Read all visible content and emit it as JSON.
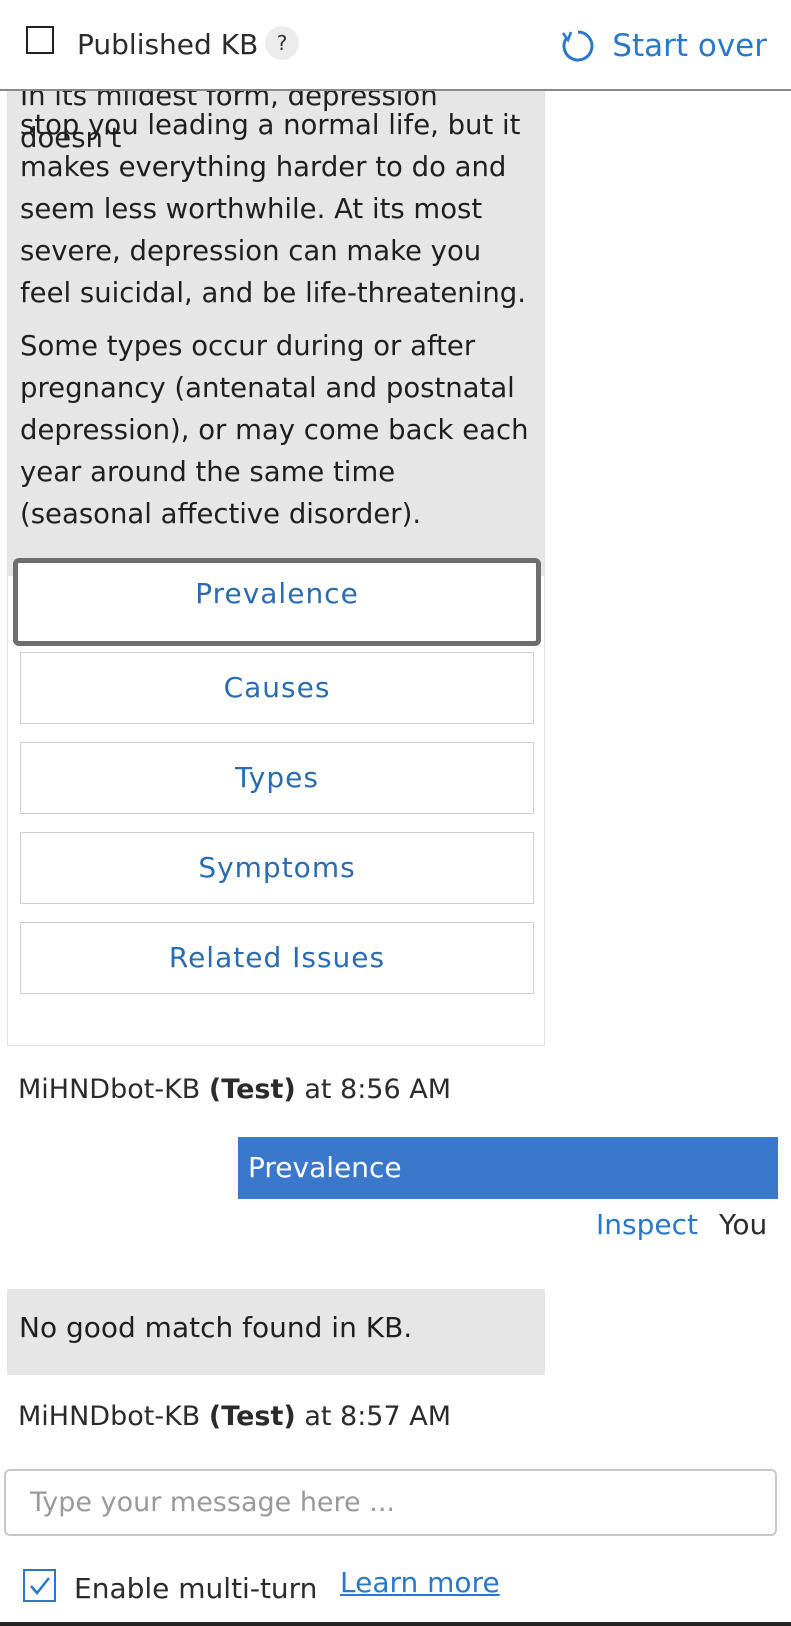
{
  "header": {
    "published_kb_label": "Published KB",
    "help_label": "?",
    "start_over_label": "Start over"
  },
  "bot_message": {
    "partial_line": "In its mildest form, depression doesn't",
    "paragraph_1": "stop you leading a normal life, but it makes everything harder to do and seem less worthwhile. At its most severe, depression can make you feel suicidal, and be life-threatening.",
    "paragraph_2": "Some types occur during or after pregnancy (antenatal and postnatal depression), or may come back each year around the same time (seasonal affective disorder).",
    "buttons": [
      "Prevalence",
      "Causes",
      "Types",
      "Symptoms",
      "Related Issues"
    ]
  },
  "meta_1": {
    "bot_name": "MiHNDbot-KB",
    "tag": "(Test)",
    "time": "at 8:56 AM"
  },
  "user_message": {
    "text": "Prevalence",
    "inspect_label": "Inspect",
    "sender": "You"
  },
  "bot_reply": {
    "text": "No good match found in KB."
  },
  "meta_2": {
    "bot_name": "MiHNDbot-KB",
    "tag": "(Test)",
    "time": "at 8:57 AM"
  },
  "input": {
    "placeholder": "Type your message here ...",
    "value": ""
  },
  "footer": {
    "multi_turn_label": "Enable multi-turn",
    "multi_turn_checked": true,
    "learn_more_label": "Learn more"
  },
  "colors": {
    "accent": "#2b78c8",
    "user_bubble": "#3a78cc",
    "bot_bubble": "#e6e6e6"
  }
}
